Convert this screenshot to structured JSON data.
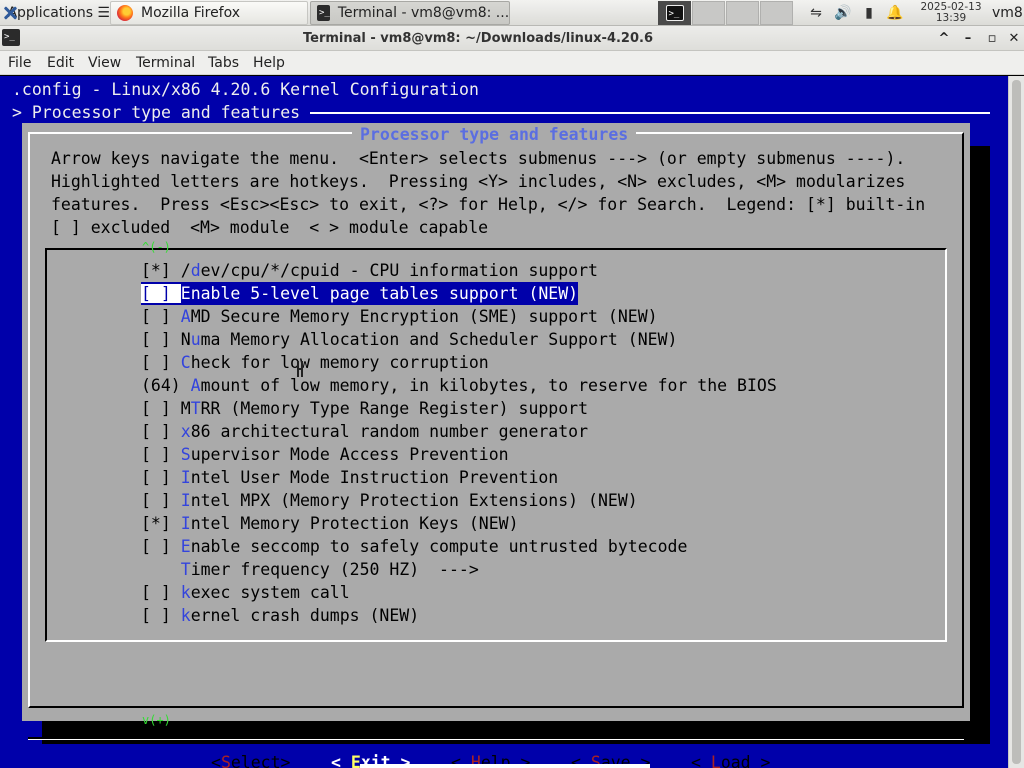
{
  "taskbar": {
    "apps_label": "Applications ☰",
    "tasks": [
      {
        "label": "Mozilla Firefox"
      },
      {
        "label": "Terminal - vm8@vm8: ..."
      }
    ],
    "clock_date": "2025-02-13",
    "clock_time": "13:39",
    "user": "vm8"
  },
  "window": {
    "title": "Terminal - vm8@vm8: ~/Downloads/linux-4.20.6",
    "buttons": {
      "shade": "^",
      "minimize": "–",
      "maximize": "▫",
      "close": "✕"
    }
  },
  "menubar": [
    "File",
    "Edit",
    "View",
    "Terminal",
    "Tabs",
    "Help"
  ],
  "config": {
    "title": ".config - Linux/x86 4.20.6 Kernel Configuration",
    "breadcrumb": "> Processor type and features",
    "dialog_title": "Processor type and features",
    "help_lines": [
      "Arrow keys navigate the menu.  <Enter> selects submenus ---> (or empty submenus ----).",
      "Highlighted letters are hotkeys.  Pressing <Y> includes, <N> excludes, <M> modularizes",
      "features.  Press <Esc><Esc> to exit, <?> for Help, </> for Search.  Legend: [*] built-in",
      "[ ] excluded  <M> module  < > module capable"
    ],
    "scroll_up_indicator": "^(-)",
    "scroll_down_indicator": "v(+)",
    "items": [
      {
        "prefix": "[*] ",
        "pre": "/",
        "hk": "d",
        "rest": "ev/cpu/*/cpuid - CPU information support"
      },
      {
        "prefix": "[ ] ",
        "pre": "",
        "hk": "E",
        "rest": "nable 5-level page tables support (NEW)",
        "selected": true
      },
      {
        "prefix": "[ ] ",
        "pre": "",
        "hk": "A",
        "rest": "MD Secure Memory Encryption (SME) support (NEW)"
      },
      {
        "prefix": "[ ] ",
        "pre": "N",
        "hk": "u",
        "rest": "ma Memory Allocation and Scheduler Support (NEW)"
      },
      {
        "prefix": "[ ] ",
        "pre": "",
        "hk": "C",
        "rest": "heck for low memory corruption"
      },
      {
        "prefix": "(64) ",
        "pre": "",
        "hk": "A",
        "rest": "mount of low memory, in kilobytes, to reserve for the BIOS"
      },
      {
        "prefix": "[ ] ",
        "pre": "M",
        "hk": "T",
        "rest": "RR (Memory Type Range Register) support"
      },
      {
        "prefix": "[ ] ",
        "pre": "",
        "hk": "x",
        "rest": "86 architectural random number generator"
      },
      {
        "prefix": "[ ] ",
        "pre": "",
        "hk": "S",
        "rest": "upervisor Mode Access Prevention"
      },
      {
        "prefix": "[ ] ",
        "pre": "",
        "hk": "I",
        "rest": "ntel User Mode Instruction Prevention"
      },
      {
        "prefix": "[ ] ",
        "pre": "",
        "hk": "I",
        "rest": "ntel MPX (Memory Protection Extensions) (NEW)"
      },
      {
        "prefix": "[*] ",
        "pre": "",
        "hk": "I",
        "rest": "ntel Memory Protection Keys (NEW)"
      },
      {
        "prefix": "[ ] ",
        "pre": "",
        "hk": "E",
        "rest": "nable seccomp to safely compute untrusted bytecode"
      },
      {
        "prefix": "    ",
        "pre": "",
        "hk": "T",
        "rest": "imer frequency (250 HZ)  --->"
      },
      {
        "prefix": "[ ] ",
        "pre": "",
        "hk": "k",
        "rest": "exec system call"
      },
      {
        "prefix": "[ ] ",
        "pre": "",
        "hk": "k",
        "rest": "ernel crash dumps (NEW)"
      }
    ],
    "buttons": [
      {
        "l": "<",
        "hk": "S",
        "r": "elect>",
        "id": "select"
      },
      {
        "l": "< ",
        "hk": "E",
        "r": "xit >",
        "id": "exit",
        "selected": true
      },
      {
        "l": "< ",
        "hk": "H",
        "r": "elp >",
        "id": "help"
      },
      {
        "l": "< ",
        "hk": "S",
        "r": "ave >",
        "id": "save"
      },
      {
        "l": "< ",
        "hk": "L",
        "r": "oad >",
        "id": "load"
      }
    ]
  },
  "colors": {
    "terminal_bg": "#0000aa",
    "dialog_bg": "#aaaaaa",
    "hotkey": "#3344dd",
    "title": "#5b6ee1"
  },
  "icons": {
    "apps": "xfce-x-icon",
    "firefox": "firefox-icon",
    "terminal": "terminal-icon",
    "network": "network-icon",
    "volume": "volume-icon",
    "battery": "battery-icon",
    "notifications": "bell-icon"
  }
}
